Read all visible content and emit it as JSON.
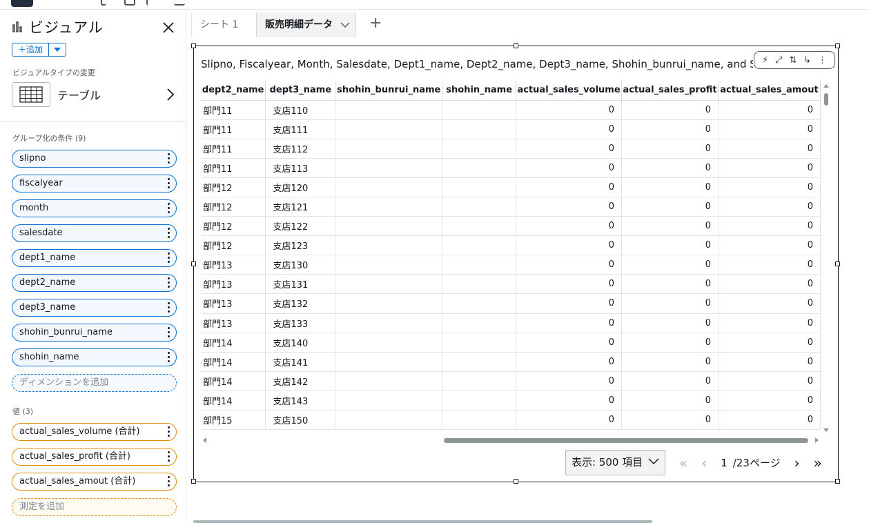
{
  "left_panel": {
    "title": "ビジュアル",
    "add_label": "＋追加",
    "visual_type_label": "ビジュアルタイプの変更",
    "visual_type": "テーブル",
    "group_by_title": "グループ化の条件 (9)",
    "dimensions": [
      "slipno",
      "fiscalyear",
      "month",
      "salesdate",
      "dept1_name",
      "dept2_name",
      "dept3_name",
      "shohin_bunrui_name",
      "shohin_name"
    ],
    "add_dimension": "ディメンションを追加",
    "values_title": "値 (3)",
    "measures": [
      "actual_sales_volume (合計)",
      "actual_sales_profit (合計)",
      "actual_sales_amout (合計)"
    ],
    "add_measure": "測定を追加"
  },
  "tabs": {
    "sheet1": "シート 1",
    "active": "販売明細データ",
    "add": "+"
  },
  "visual": {
    "title": "Slipno, Fiscalyear, Month, Salesdate, Dept1_name, Dept2_name, Dept3_name, Shohin_bunrui_name, and Shohin_name",
    "menu_icons": [
      "insights-icon",
      "expand-icon",
      "sort-icon",
      "drill-icon",
      "more-icon"
    ]
  },
  "table": {
    "columns": [
      "dept2_name",
      "dept3_name",
      "shohin_bunrui_name",
      "shohin_name",
      "actual_sales_volume",
      "actual_sales_profit",
      "actual_sales_amout"
    ],
    "rows": [
      [
        "部門11",
        "支店110",
        "",
        "",
        "0",
        "0",
        "0"
      ],
      [
        "部門11",
        "支店111",
        "",
        "",
        "0",
        "0",
        "0"
      ],
      [
        "部門11",
        "支店112",
        "",
        "",
        "0",
        "0",
        "0"
      ],
      [
        "部門11",
        "支店113",
        "",
        "",
        "0",
        "0",
        "0"
      ],
      [
        "部門12",
        "支店120",
        "",
        "",
        "0",
        "0",
        "0"
      ],
      [
        "部門12",
        "支店121",
        "",
        "",
        "0",
        "0",
        "0"
      ],
      [
        "部門12",
        "支店122",
        "",
        "",
        "0",
        "0",
        "0"
      ],
      [
        "部門12",
        "支店123",
        "",
        "",
        "0",
        "0",
        "0"
      ],
      [
        "部門13",
        "支店130",
        "",
        "",
        "0",
        "0",
        "0"
      ],
      [
        "部門13",
        "支店131",
        "",
        "",
        "0",
        "0",
        "0"
      ],
      [
        "部門13",
        "支店132",
        "",
        "",
        "0",
        "0",
        "0"
      ],
      [
        "部門13",
        "支店133",
        "",
        "",
        "0",
        "0",
        "0"
      ],
      [
        "部門14",
        "支店140",
        "",
        "",
        "0",
        "0",
        "0"
      ],
      [
        "部門14",
        "支店141",
        "",
        "",
        "0",
        "0",
        "0"
      ],
      [
        "部門14",
        "支店142",
        "",
        "",
        "0",
        "0",
        "0"
      ],
      [
        "部門14",
        "支店143",
        "",
        "",
        "0",
        "0",
        "0"
      ],
      [
        "部門15",
        "支店150",
        "",
        "",
        "0",
        "0",
        "0"
      ]
    ]
  },
  "pager": {
    "page_size": "表示: 500 項目",
    "current_page": "1",
    "total_pages": "/23ページ"
  },
  "colors": {
    "dimension_border": "#0972d3",
    "measure_border": "#e08e0b",
    "selection_border": "#16191f"
  }
}
